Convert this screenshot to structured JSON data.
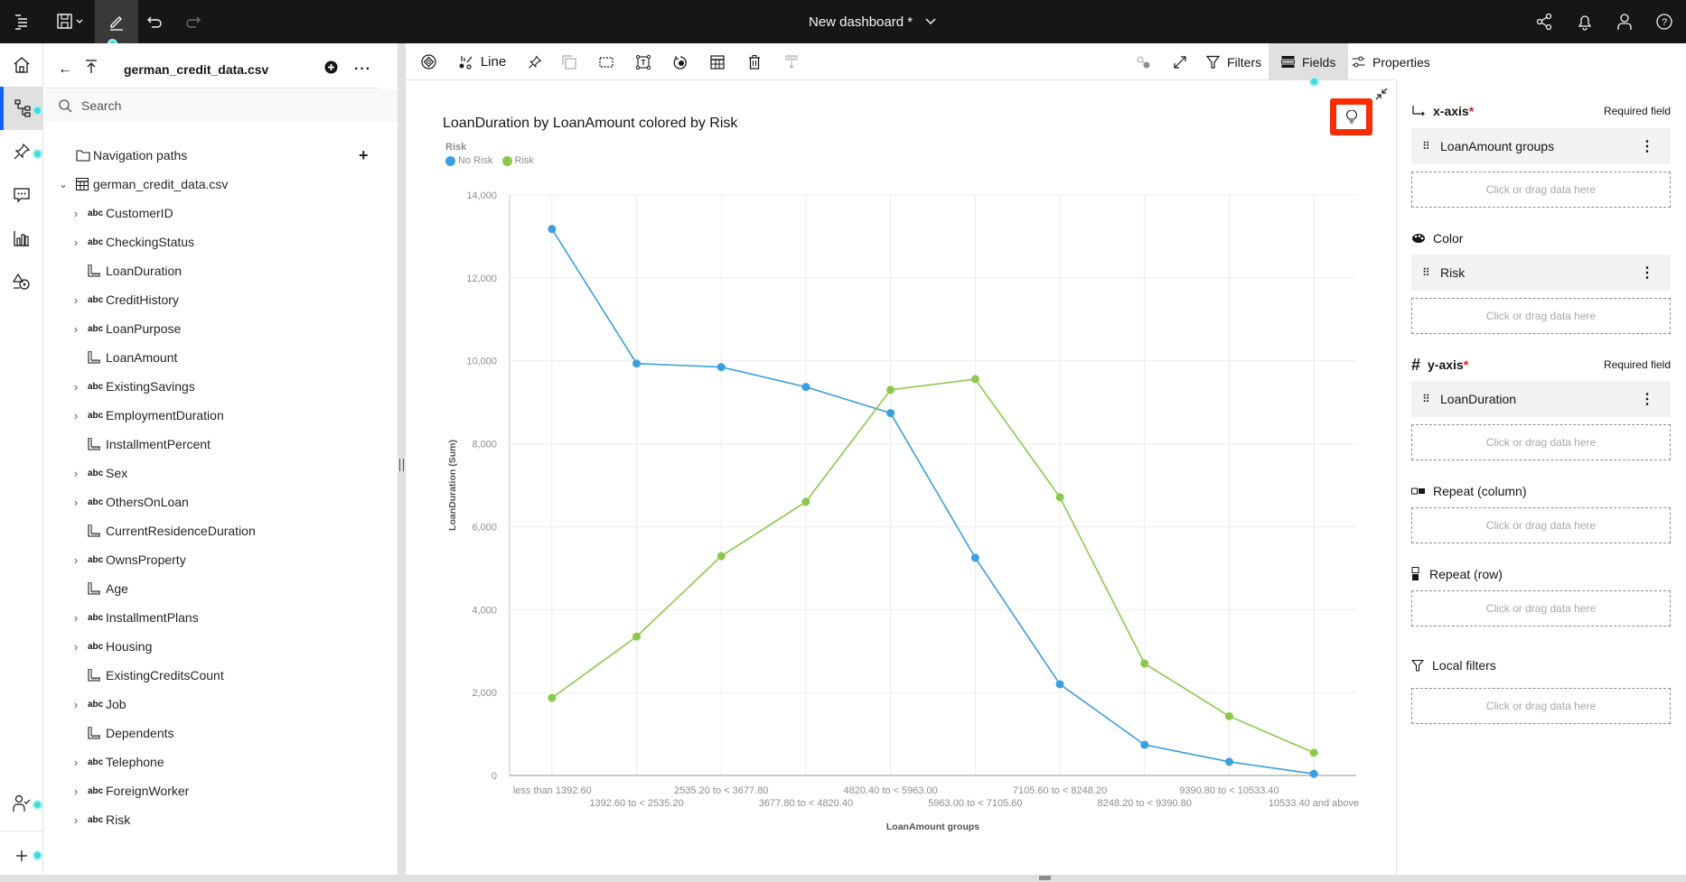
{
  "topbar": {
    "title": "New dashboard *",
    "icons": [
      "menu-icon",
      "save-icon",
      "edit-icon",
      "undo-icon",
      "redo-icon",
      "share-icon",
      "notification-icon",
      "user-icon",
      "help-icon"
    ]
  },
  "rail": {
    "items": [
      "home",
      "data-sources",
      "pins",
      "comments",
      "visualizations",
      "assistant",
      "user-check",
      "add"
    ]
  },
  "left_panel": {
    "title": "german_credit_data.csv",
    "search_placeholder": "Search",
    "navigation_paths": "Navigation paths",
    "dataset": "german_credit_data.csv",
    "fields": [
      {
        "name": "CustomerID",
        "type": "abc",
        "expandable": true
      },
      {
        "name": "CheckingStatus",
        "type": "abc",
        "expandable": true
      },
      {
        "name": "LoanDuration",
        "type": "measure",
        "expandable": false
      },
      {
        "name": "CreditHistory",
        "type": "abc",
        "expandable": true
      },
      {
        "name": "LoanPurpose",
        "type": "abc",
        "expandable": true
      },
      {
        "name": "LoanAmount",
        "type": "measure",
        "expandable": false
      },
      {
        "name": "ExistingSavings",
        "type": "abc",
        "expandable": true
      },
      {
        "name": "EmploymentDuration",
        "type": "abc",
        "expandable": true
      },
      {
        "name": "InstallmentPercent",
        "type": "measure",
        "expandable": false
      },
      {
        "name": "Sex",
        "type": "abc",
        "expandable": true
      },
      {
        "name": "OthersOnLoan",
        "type": "abc",
        "expandable": true
      },
      {
        "name": "CurrentResidenceDuration",
        "type": "measure",
        "expandable": false
      },
      {
        "name": "OwnsProperty",
        "type": "abc",
        "expandable": true
      },
      {
        "name": "Age",
        "type": "measure",
        "expandable": false
      },
      {
        "name": "InstallmentPlans",
        "type": "abc",
        "expandable": true
      },
      {
        "name": "Housing",
        "type": "abc",
        "expandable": true
      },
      {
        "name": "ExistingCreditsCount",
        "type": "measure",
        "expandable": false
      },
      {
        "name": "Job",
        "type": "abc",
        "expandable": true
      },
      {
        "name": "Dependents",
        "type": "measure",
        "expandable": false
      },
      {
        "name": "Telephone",
        "type": "abc",
        "expandable": true
      },
      {
        "name": "ForeignWorker",
        "type": "abc",
        "expandable": true
      },
      {
        "name": "Risk",
        "type": "abc",
        "expandable": true
      }
    ],
    "type_label": "abc"
  },
  "toolbar": {
    "chart_type": "Line",
    "filters": "Filters",
    "fields": "Fields",
    "properties": "Properties"
  },
  "chart_data": {
    "type": "line",
    "title": "LoanDuration by LoanAmount colored by Risk",
    "legend_title": "Risk",
    "legend_position": "top-left",
    "xlabel": "LoanAmount groups",
    "ylabel": "LoanDuration (Sum)",
    "ylim": [
      0,
      14000
    ],
    "yticks": [
      0,
      2000,
      4000,
      6000,
      8000,
      10000,
      12000,
      14000
    ],
    "ytick_labels": [
      "0",
      "2,000",
      "4,000",
      "6,000",
      "8,000",
      "10,000",
      "12,000",
      "14,000"
    ],
    "grid": true,
    "categories": [
      "less than 1392.60",
      "1392.60 to < 2535.20",
      "2535.20 to < 3677.80",
      "3677.80 to < 4820.40",
      "4820.40 to < 5963.00",
      "5963.00 to < 7105.60",
      "7105.60 to < 8248.20",
      "8248.20 to < 9390.80",
      "9390.80 to < 10533.40",
      "10533.40 and above"
    ],
    "series": [
      {
        "name": "No Risk",
        "color": "#3b9ede",
        "values": [
          13180,
          9935,
          9850,
          9370,
          8740,
          5250,
          2200,
          740,
          330,
          40
        ]
      },
      {
        "name": "Risk",
        "color": "#8cc84b",
        "values": [
          1870,
          3350,
          5290,
          6600,
          9300,
          9560,
          6710,
          2700,
          1430,
          550
        ]
      }
    ]
  },
  "right_panel": {
    "required_label": "Required field",
    "dropzone_label": "Click or drag data here",
    "sections": {
      "x_axis": {
        "label": "x-axis",
        "field": "LoanAmount groups"
      },
      "color": {
        "label": "Color",
        "field": "Risk"
      },
      "y_axis": {
        "label": "y-axis",
        "field": "LoanDuration"
      },
      "repeat_column": {
        "label": "Repeat (column)"
      },
      "repeat_row": {
        "label": "Repeat (row)"
      },
      "local_filters": {
        "label": "Local filters"
      }
    }
  },
  "colors": {
    "accent": "#0f62fe",
    "highlight": "#fa2c00",
    "status_dot": "#3ddbd9"
  }
}
